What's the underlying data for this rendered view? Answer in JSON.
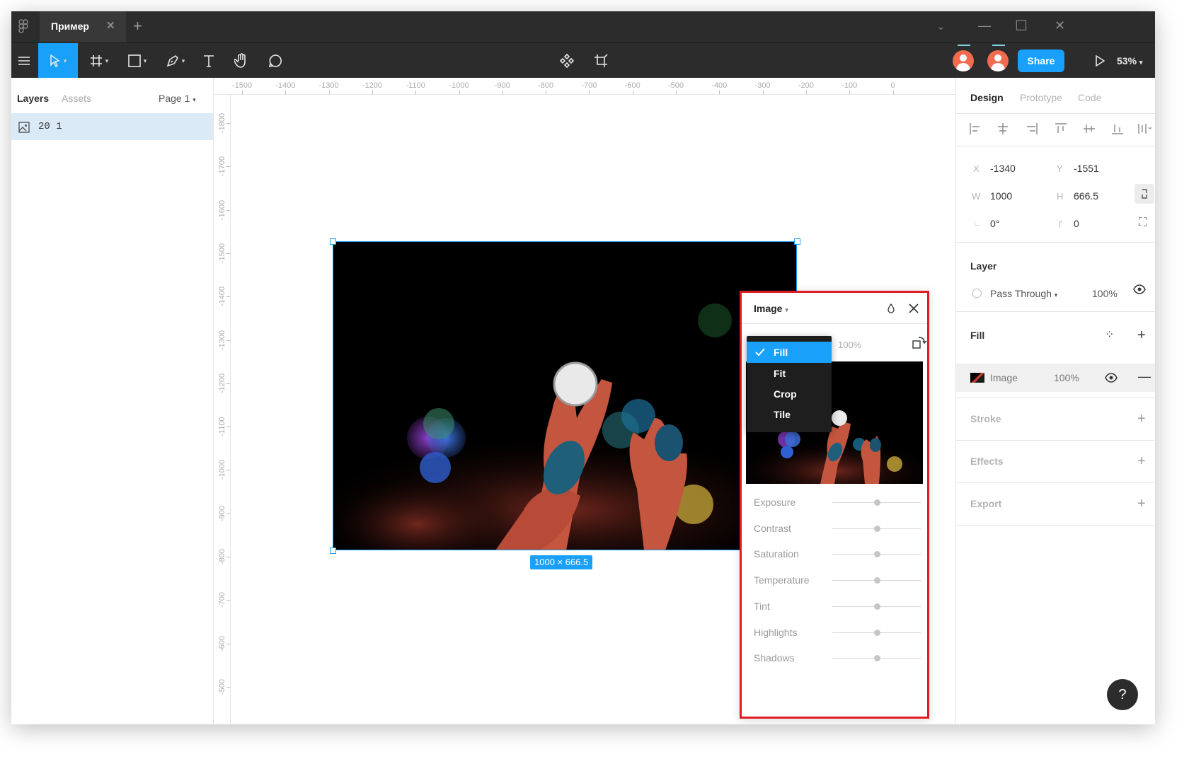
{
  "window": {
    "tab_title": "Пример",
    "tab_close": "✕",
    "tab_add": "+"
  },
  "toolbar": {
    "share_label": "Share",
    "zoom_label": "53%"
  },
  "left_panel": {
    "tabs": [
      "Layers",
      "Assets"
    ],
    "page_selector": "Page 1",
    "layer_name": "20 1"
  },
  "rulers": {
    "top": [
      "-1500",
      "-1400",
      "-1300",
      "-1200",
      "-1100",
      "-1000",
      "-900",
      "-800",
      "-700",
      "-600",
      "-500",
      "-400",
      "-300",
      "-200",
      "-100",
      "0"
    ],
    "left": [
      "-1800",
      "-1700",
      "-1600",
      "-1500",
      "-1400",
      "-1300",
      "-1200",
      "-1100",
      "-1000",
      "-900",
      "-800",
      "-700",
      "-600",
      "-500"
    ]
  },
  "canvas": {
    "selection_size": "1000 × 666.5"
  },
  "image_popover": {
    "title": "Image",
    "opacity": "100%",
    "menu_items": [
      "Fill",
      "Fit",
      "Crop",
      "Tile"
    ],
    "selected_mode": "Fill",
    "adjustments": [
      {
        "label": "Exposure",
        "value": 0.5
      },
      {
        "label": "Contrast",
        "value": 0.5
      },
      {
        "label": "Saturation",
        "value": 0.5
      },
      {
        "label": "Temperature",
        "value": 0.5
      },
      {
        "label": "Tint",
        "value": 0.5
      },
      {
        "label": "Highlights",
        "value": 0.5
      },
      {
        "label": "Shadows",
        "value": 0.5
      }
    ]
  },
  "right_panel": {
    "tabs": [
      "Design",
      "Prototype",
      "Code"
    ],
    "x_label": "X",
    "x_value": "-1340",
    "y_label": "Y",
    "y_value": "-1551",
    "w_label": "W",
    "w_value": "1000",
    "h_label": "H",
    "h_value": "666.5",
    "rotation": "0°",
    "radius": "0",
    "layer_section": "Layer",
    "blend_mode": "Pass Through",
    "layer_opacity": "100%",
    "fill_section": "Fill",
    "fill_name": "Image",
    "fill_opacity": "100%",
    "stroke_section": "Stroke",
    "effects_section": "Effects",
    "export_section": "Export"
  },
  "help_label": "?",
  "colors": {
    "accent": "#18a0fb",
    "dark_chrome": "#2c2c2c",
    "highlight_border": "#e11b22",
    "avatar": "#f26b4e"
  },
  "icons": [
    "figma-logo-icon",
    "menu-icon",
    "move-tool-icon",
    "frame-tool-icon",
    "shape-tool-icon",
    "pen-tool-icon",
    "text-tool-icon",
    "hand-tool-icon",
    "comment-tool-icon",
    "component-icon",
    "crop-icon",
    "play-icon",
    "eye-icon",
    "image-layer-icon",
    "close-icon",
    "drop-icon",
    "rotate-icon",
    "check-icon",
    "help-icon"
  ]
}
